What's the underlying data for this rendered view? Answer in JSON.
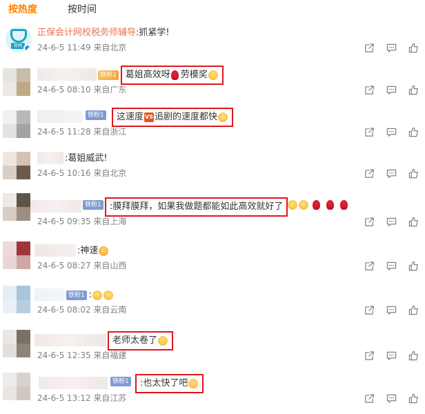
{
  "tabs": [
    {
      "label": "按热度",
      "active": true
    },
    {
      "label": "按时间",
      "active": false
    }
  ],
  "comments": [
    {
      "name": "正保会计网校税务师辅导",
      "text": ":抓紧学!",
      "meta": "24-6-5 11:49 来自北京",
      "avatar_badge": "官网"
    },
    {
      "badge": "铁粉2",
      "text": "葛姐高效呀",
      "meta": "24-6-5 08:10 来自广东"
    },
    {
      "badge": "铁粉1",
      "text": "这速度",
      "text2": "追剧的速度都快",
      "meta": "24-6-5 11:28 来自浙江"
    },
    {
      "text": ":葛姐威武!",
      "meta": "24-6-5 10:16 来自北京"
    },
    {
      "badge": "铁粉1",
      "text": ":膜拜膜拜，如果我做题都能如此高效就好了",
      "meta": "24-6-5 09:35 来自上海"
    },
    {
      "text": ":神速",
      "meta": "24-6-5 08:27 来自山西"
    },
    {
      "badge": "铁粉1",
      "text": ":",
      "meta": "24-6-5 08:02 来自云南"
    },
    {
      "text": "老师太卷了",
      "meta": "24-6-5 12:35 来自福建"
    },
    {
      "badge": "铁粉1",
      "text": ":也太快了吧",
      "meta": "24-6-5 13:12 来自江苏"
    }
  ],
  "icons": {
    "share": "share-icon",
    "comment": "comment-icon",
    "like": "like-icon"
  },
  "colors": {
    "accent": "#ff8200",
    "highlight_border": "#e0151b",
    "name_link": "#eb7350",
    "meta": "#808080"
  }
}
